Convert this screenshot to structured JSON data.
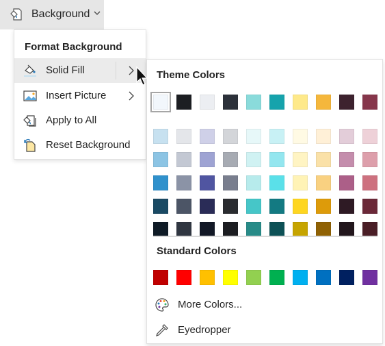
{
  "ribbon": {
    "button_label": "Background",
    "icon": "background-format-icon"
  },
  "menu": {
    "title": "Format Background",
    "items": [
      {
        "label": "Solid Fill",
        "icon": "paint-bucket-icon",
        "has_submenu": true,
        "active": true
      },
      {
        "label": "Insert Picture",
        "icon": "picture-icon",
        "has_submenu": true,
        "active": false
      },
      {
        "label": "Apply to All",
        "icon": "apply-all-icon",
        "has_submenu": false,
        "active": false
      },
      {
        "label": "Reset Background",
        "icon": "reset-background-icon",
        "has_submenu": false,
        "active": false
      }
    ]
  },
  "color_panel": {
    "theme_title": "Theme Colors",
    "theme_colors": [
      [
        "#f2f7fc",
        "#1c1e22",
        "#eceef2",
        "#2c313a",
        "#8adbdb",
        "#16a3ac",
        "#fee98a",
        "#f5b73c",
        "#3d222e",
        "#86364b"
      ],
      [
        "#c7e1f0",
        "#e4e6ea",
        "#cfd0e8",
        "#d3d5d9",
        "#e7f8f9",
        "#c8f1f5",
        "#fffae4",
        "#fff0d7",
        "#e3cdd9",
        "#eed1d8"
      ],
      [
        "#8cc4e4",
        "#c3c8d3",
        "#9ea3d3",
        "#a7abb3",
        "#d0f2f3",
        "#93e6ef",
        "#fff4c3",
        "#fae1a8",
        "#c48dac",
        "#dd9fab"
      ],
      [
        "#3091cc",
        "#8b93a6",
        "#5055a1",
        "#797e8e",
        "#b7ebec",
        "#5ae0e9",
        "#fff3b6",
        "#f9d181",
        "#ac5f88",
        "#cd717f"
      ],
      [
        "#1a4a64",
        "#4c5566",
        "#2a2c57",
        "#2a2c30",
        "#46c6c8",
        "#137a82",
        "#fed621",
        "#dd9b0a",
        "#2e1a24",
        "#6b2938"
      ],
      [
        "#0f1b26",
        "#303641",
        "#121826",
        "#1c1d21",
        "#288b88",
        "#0d5156",
        "#c6a400",
        "#8f6104",
        "#22161c",
        "#4a1e26"
      ]
    ],
    "selected_theme_color": [
      0,
      0
    ],
    "standard_title": "Standard Colors",
    "standard_colors": [
      "#c00000",
      "#ff0000",
      "#ffc000",
      "#ffff00",
      "#92d050",
      "#00b050",
      "#00b0f0",
      "#0070c0",
      "#002060",
      "#7030a0"
    ],
    "actions": [
      {
        "label": "More Colors...",
        "icon": "palette-icon"
      },
      {
        "label": "Eyedropper",
        "icon": "eyedropper-icon"
      }
    ]
  }
}
